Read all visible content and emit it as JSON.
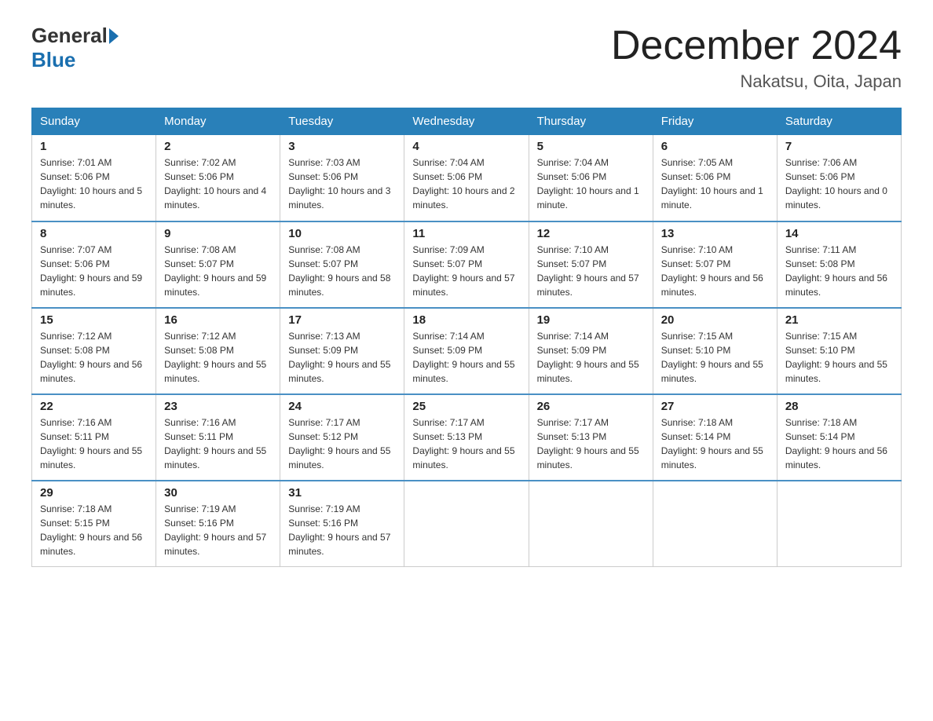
{
  "header": {
    "logo_general": "General",
    "logo_blue": "Blue",
    "title": "December 2024",
    "location": "Nakatsu, Oita, Japan"
  },
  "days_of_week": [
    "Sunday",
    "Monday",
    "Tuesday",
    "Wednesday",
    "Thursday",
    "Friday",
    "Saturday"
  ],
  "weeks": [
    [
      {
        "day": "1",
        "sunrise": "7:01 AM",
        "sunset": "5:06 PM",
        "daylight": "10 hours and 5 minutes."
      },
      {
        "day": "2",
        "sunrise": "7:02 AM",
        "sunset": "5:06 PM",
        "daylight": "10 hours and 4 minutes."
      },
      {
        "day": "3",
        "sunrise": "7:03 AM",
        "sunset": "5:06 PM",
        "daylight": "10 hours and 3 minutes."
      },
      {
        "day": "4",
        "sunrise": "7:04 AM",
        "sunset": "5:06 PM",
        "daylight": "10 hours and 2 minutes."
      },
      {
        "day": "5",
        "sunrise": "7:04 AM",
        "sunset": "5:06 PM",
        "daylight": "10 hours and 1 minute."
      },
      {
        "day": "6",
        "sunrise": "7:05 AM",
        "sunset": "5:06 PM",
        "daylight": "10 hours and 1 minute."
      },
      {
        "day": "7",
        "sunrise": "7:06 AM",
        "sunset": "5:06 PM",
        "daylight": "10 hours and 0 minutes."
      }
    ],
    [
      {
        "day": "8",
        "sunrise": "7:07 AM",
        "sunset": "5:06 PM",
        "daylight": "9 hours and 59 minutes."
      },
      {
        "day": "9",
        "sunrise": "7:08 AM",
        "sunset": "5:07 PM",
        "daylight": "9 hours and 59 minutes."
      },
      {
        "day": "10",
        "sunrise": "7:08 AM",
        "sunset": "5:07 PM",
        "daylight": "9 hours and 58 minutes."
      },
      {
        "day": "11",
        "sunrise": "7:09 AM",
        "sunset": "5:07 PM",
        "daylight": "9 hours and 57 minutes."
      },
      {
        "day": "12",
        "sunrise": "7:10 AM",
        "sunset": "5:07 PM",
        "daylight": "9 hours and 57 minutes."
      },
      {
        "day": "13",
        "sunrise": "7:10 AM",
        "sunset": "5:07 PM",
        "daylight": "9 hours and 56 minutes."
      },
      {
        "day": "14",
        "sunrise": "7:11 AM",
        "sunset": "5:08 PM",
        "daylight": "9 hours and 56 minutes."
      }
    ],
    [
      {
        "day": "15",
        "sunrise": "7:12 AM",
        "sunset": "5:08 PM",
        "daylight": "9 hours and 56 minutes."
      },
      {
        "day": "16",
        "sunrise": "7:12 AM",
        "sunset": "5:08 PM",
        "daylight": "9 hours and 55 minutes."
      },
      {
        "day": "17",
        "sunrise": "7:13 AM",
        "sunset": "5:09 PM",
        "daylight": "9 hours and 55 minutes."
      },
      {
        "day": "18",
        "sunrise": "7:14 AM",
        "sunset": "5:09 PM",
        "daylight": "9 hours and 55 minutes."
      },
      {
        "day": "19",
        "sunrise": "7:14 AM",
        "sunset": "5:09 PM",
        "daylight": "9 hours and 55 minutes."
      },
      {
        "day": "20",
        "sunrise": "7:15 AM",
        "sunset": "5:10 PM",
        "daylight": "9 hours and 55 minutes."
      },
      {
        "day": "21",
        "sunrise": "7:15 AM",
        "sunset": "5:10 PM",
        "daylight": "9 hours and 55 minutes."
      }
    ],
    [
      {
        "day": "22",
        "sunrise": "7:16 AM",
        "sunset": "5:11 PM",
        "daylight": "9 hours and 55 minutes."
      },
      {
        "day": "23",
        "sunrise": "7:16 AM",
        "sunset": "5:11 PM",
        "daylight": "9 hours and 55 minutes."
      },
      {
        "day": "24",
        "sunrise": "7:17 AM",
        "sunset": "5:12 PM",
        "daylight": "9 hours and 55 minutes."
      },
      {
        "day": "25",
        "sunrise": "7:17 AM",
        "sunset": "5:13 PM",
        "daylight": "9 hours and 55 minutes."
      },
      {
        "day": "26",
        "sunrise": "7:17 AM",
        "sunset": "5:13 PM",
        "daylight": "9 hours and 55 minutes."
      },
      {
        "day": "27",
        "sunrise": "7:18 AM",
        "sunset": "5:14 PM",
        "daylight": "9 hours and 55 minutes."
      },
      {
        "day": "28",
        "sunrise": "7:18 AM",
        "sunset": "5:14 PM",
        "daylight": "9 hours and 56 minutes."
      }
    ],
    [
      {
        "day": "29",
        "sunrise": "7:18 AM",
        "sunset": "5:15 PM",
        "daylight": "9 hours and 56 minutes."
      },
      {
        "day": "30",
        "sunrise": "7:19 AM",
        "sunset": "5:16 PM",
        "daylight": "9 hours and 57 minutes."
      },
      {
        "day": "31",
        "sunrise": "7:19 AM",
        "sunset": "5:16 PM",
        "daylight": "9 hours and 57 minutes."
      },
      null,
      null,
      null,
      null
    ]
  ]
}
